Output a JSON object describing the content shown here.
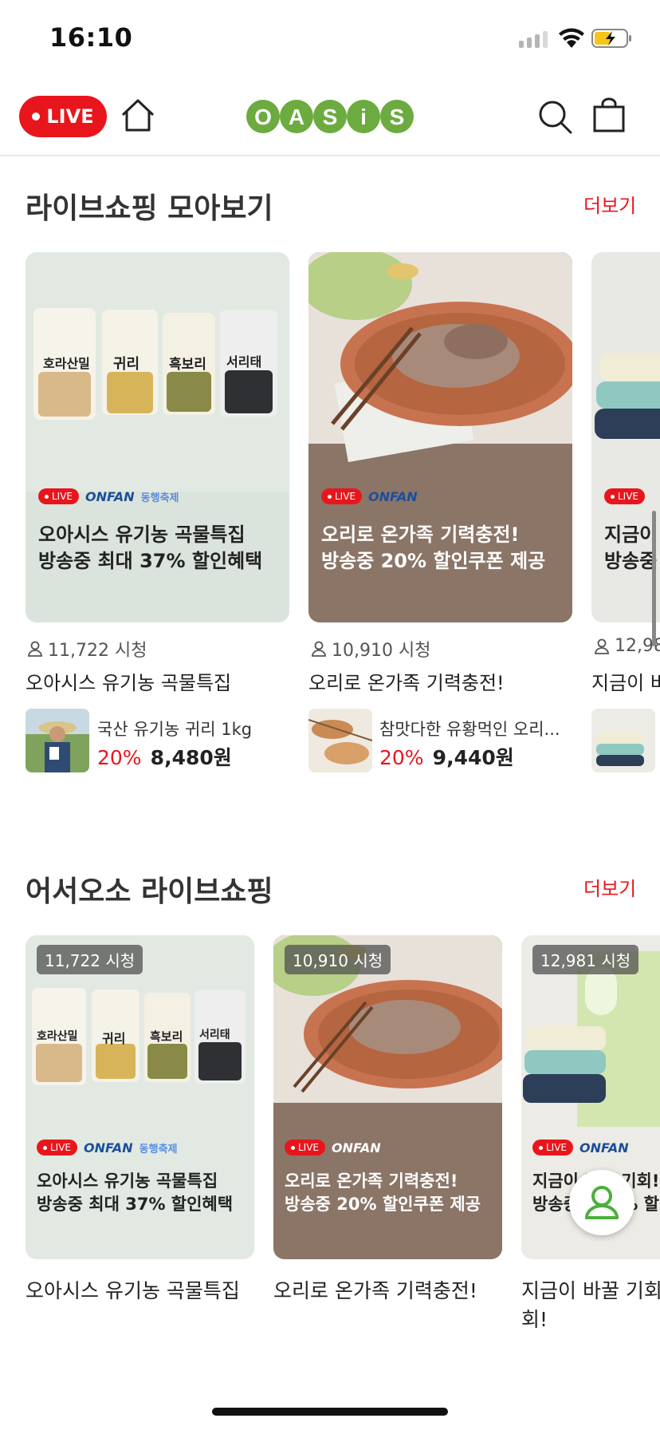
{
  "status_bar": {
    "time": "16:10"
  },
  "header": {
    "live_label": "LIVE",
    "logo_text": "OASiS",
    "logo_color": "#6cab3f"
  },
  "section1": {
    "title": "라이브쇼핑 모아보기",
    "more": "더보기",
    "cards": [
      {
        "live": "LIVE",
        "onfan": "ONFAN",
        "festival": "동행축제",
        "line1": "오아시스 유기농 곡물특집",
        "line2": "방송중 최대 37% 할인혜택",
        "views": "11,722 시청",
        "title": "오아시스 유기농 곡물특집",
        "product": "국산 유기농 귀리 1kg",
        "discount": "20%",
        "price": "8,480원"
      },
      {
        "live": "LIVE",
        "onfan": "ONFAN",
        "line1": "오리로 온가족 기력충전!",
        "line2": "방송중 20% 할인쿠폰 제공",
        "views": "10,910 시청",
        "title": "오리로 온가족 기력충전!",
        "product": "참맛다한 유황먹인 오리...",
        "discount": "20%",
        "price": "9,440원"
      },
      {
        "live": "LIVE",
        "line1": "지금이",
        "line2": "방송중",
        "views": "12,98",
        "title": "지금이 바"
      }
    ]
  },
  "section2": {
    "title": "어서오소 라이브쇼핑",
    "more": "더보기",
    "cards": [
      {
        "views": "11,722 시청",
        "live": "LIVE",
        "onfan": "ONFAN",
        "festival": "동행축제",
        "line1": "오아시스 유기농 곡물특집",
        "line2": "방송중 최대 37% 할인혜택",
        "title": "오아시스 유기농 곡물특집"
      },
      {
        "views": "10,910 시청",
        "live": "LIVE",
        "onfan": "ONFAN",
        "line1": "오리로 온가족 기력충전!",
        "line2": "방송중 20% 할인쿠폰 제공",
        "title": "오리로 온가족 기력충전!"
      },
      {
        "views": "12,981 시청",
        "live": "LIVE",
        "onfan": "ONFAN",
        "line1": "지금이 바꿀 기회! 정",
        "line2": "방송중 최대 % 할",
        "title1": "지금이 바꿀 기회",
        "title2": "회!"
      }
    ]
  },
  "packs": [
    "호라산밀",
    "귀리",
    "흑보리",
    "서리태"
  ]
}
